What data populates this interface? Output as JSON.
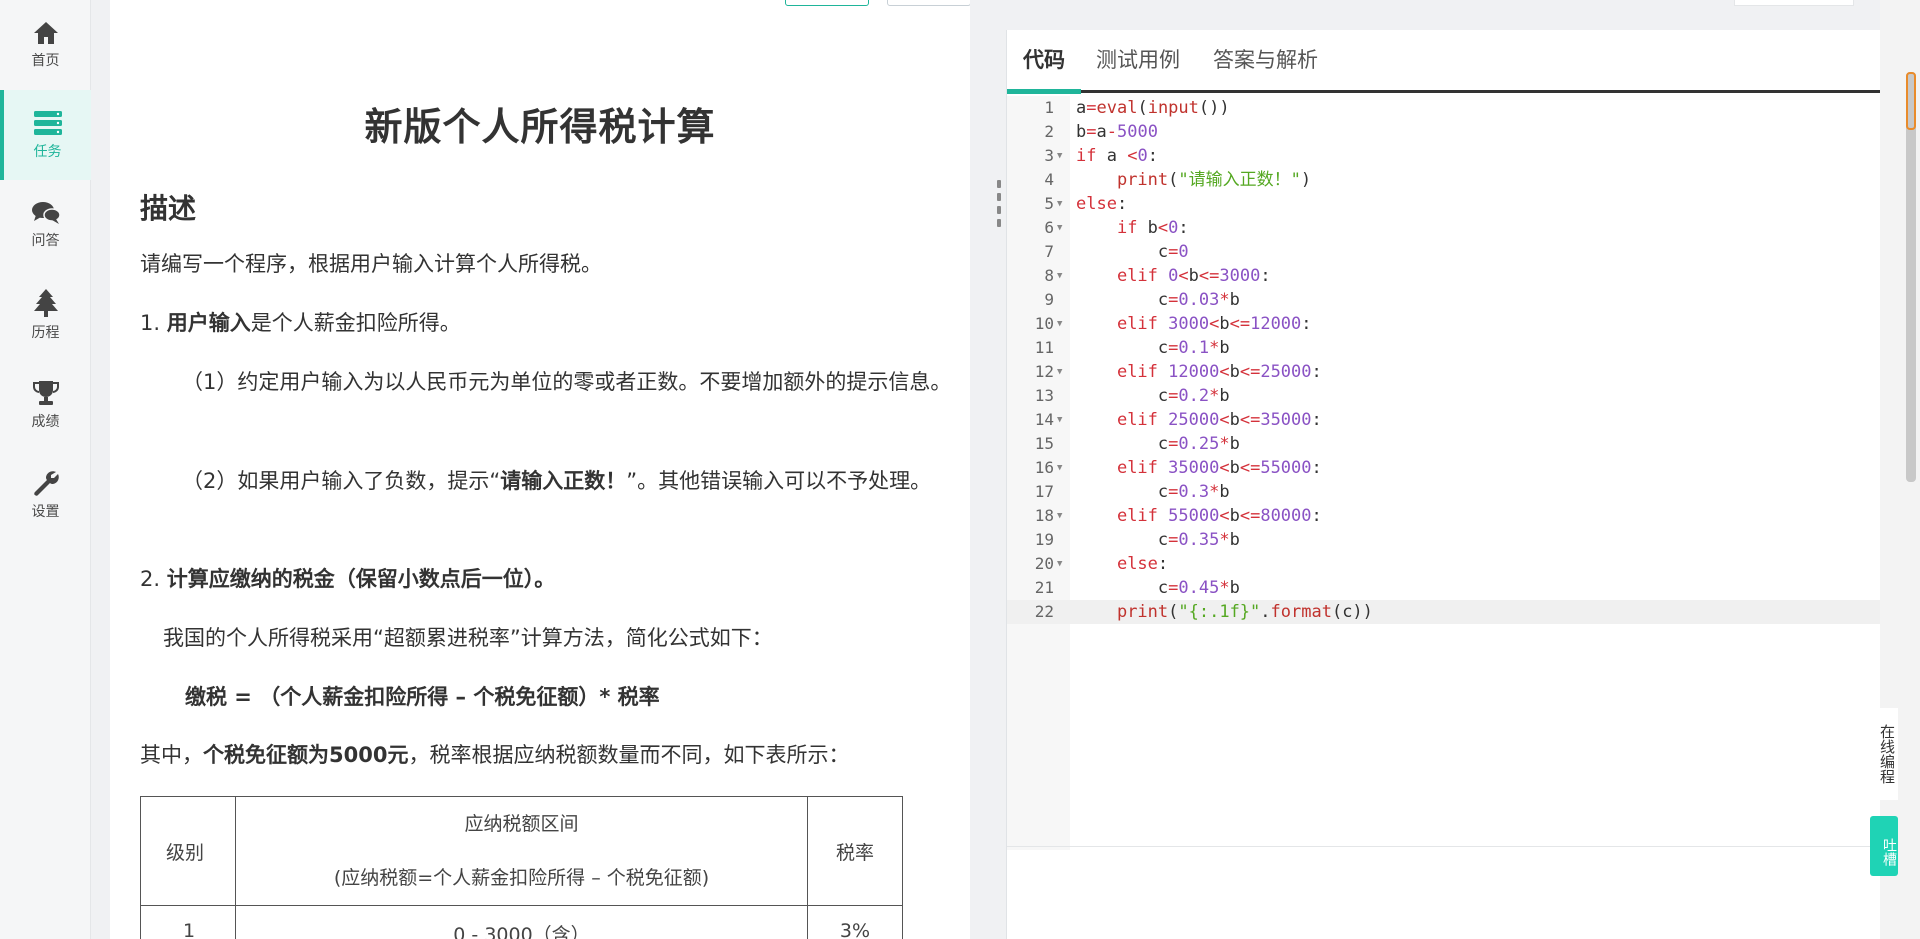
{
  "nav": {
    "items": [
      {
        "label": "首页",
        "icon": "home-icon"
      },
      {
        "label": "任务",
        "icon": "tasks-icon",
        "active": true
      },
      {
        "label": "问答",
        "icon": "chat-icon"
      },
      {
        "label": "历程",
        "icon": "tree-icon"
      },
      {
        "label": "成绩",
        "icon": "trophy-icon"
      },
      {
        "label": "设置",
        "icon": "wrench-icon"
      }
    ]
  },
  "problem": {
    "title": "新版个人所得税计算",
    "section": "描述",
    "intro": "请编写一个程序，根据用户输入计算个人所得税。",
    "p1_num": "1. ",
    "p1_bold": "用户输入",
    "p1_rest": "是个人薪金扣险所得。",
    "p2": "（1）约定用户输入为以人民币元为单位的零或者正数。不要增加额外的提示信息。",
    "p3_pre": "（2）如果用户输入了负数，提示“",
    "p3_bold": "请输入正数！",
    "p3_post": "”。其他错误输入可以不予处理。",
    "p4_num": "2. ",
    "p4_bold": "计算应缴纳的税金（保留小数点后一位）。",
    "p5": "我国的个人所得税采用“超额累进税率”计算方法，简化公式如下：",
    "formula": "缴税 = （个人薪金扣险所得 – 个税免征额）* 税率",
    "p6_pre": "其中，",
    "p6_bold": "个税免征额为5000元",
    "p6_post": "，税率根据应纳税额数量而不同，如下表所示：",
    "table": {
      "h_level": "级别",
      "h_range_line1": "应纳税额区间",
      "h_range_line2": "(应纳税额=个人薪金扣险所得 – 个税免征额)",
      "h_rate": "税率",
      "rows": [
        {
          "level": "1",
          "range": "0 - 3000（含）",
          "rate": "3%"
        }
      ]
    }
  },
  "editor": {
    "tabs": [
      {
        "label": "代码",
        "active": true
      },
      {
        "label": "测试用例"
      },
      {
        "label": "答案与解析"
      }
    ],
    "current_line": 22,
    "line_numbers": [
      "1",
      "2",
      "3",
      "4",
      "5",
      "6",
      "7",
      "8",
      "9",
      "10",
      "11",
      "12",
      "13",
      "14",
      "15",
      "16",
      "17",
      "18",
      "19",
      "20",
      "21",
      "22"
    ],
    "code_lines": [
      "a=eval(input())",
      "b=a-5000",
      "if a <0:",
      "    print(\"请输入正数！\")",
      "else:",
      "    if b<0:",
      "        c=0",
      "    elif 0<b<=3000:",
      "        c=0.03*b",
      "    elif 3000<b<=12000:",
      "        c=0.1*b",
      "    elif 12000<b<=25000:",
      "        c=0.2*b",
      "    elif 25000<b<=35000:",
      "        c=0.25*b",
      "    elif 35000<b<=55000:",
      "        c=0.3*b",
      "    elif 55000<b<=80000:",
      "        c=0.35*b",
      "    else:",
      "        c=0.45*b",
      "    print(\"{:.1f}\".format(c))"
    ]
  },
  "side": {
    "online_coding": "在线编程",
    "feedback": "吐槽"
  },
  "colors": {
    "accent": "#1fb59a"
  }
}
